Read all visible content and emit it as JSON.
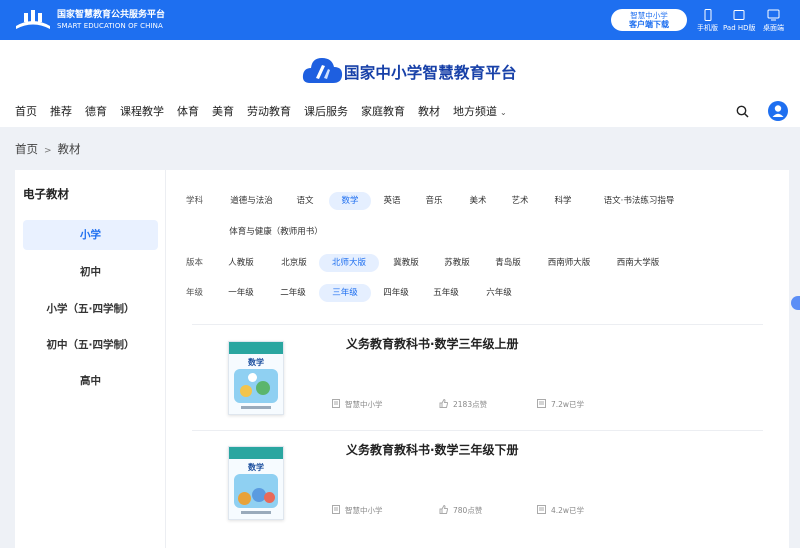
{
  "topbar": {
    "title": "国家智慧教育公共服务平台",
    "subtitle": "SMART EDUCATION OF CHINA",
    "download_line1": "智慧中小学",
    "download_line2": "客户端下载",
    "devices": [
      {
        "label": "手机版",
        "icon": "phone-icon"
      },
      {
        "label": "Pad HD版",
        "icon": "tablet-icon"
      },
      {
        "label": "桌面端",
        "icon": "desktop-icon"
      }
    ]
  },
  "header": {
    "brand": "国家中小学智慧教育平台",
    "nav": [
      "首页",
      "推荐",
      "德育",
      "课程教学",
      "体育",
      "美育",
      "劳动教育",
      "课后服务",
      "家庭教育",
      "教材",
      "地方频道"
    ]
  },
  "breadcrumb": {
    "home": "首页",
    "separator": ">",
    "current": "教材"
  },
  "sidebar": {
    "title": "电子教材",
    "items": [
      {
        "label": "小学",
        "active": true
      },
      {
        "label": "初中",
        "active": false
      },
      {
        "label": "小学（五·四学制）",
        "active": false
      },
      {
        "label": "初中（五·四学制）",
        "active": false
      },
      {
        "label": "高中",
        "active": false
      }
    ]
  },
  "filters": {
    "subject": {
      "label": "学科",
      "options": [
        "道德与法治",
        "语文",
        "数学",
        "英语",
        "音乐",
        "美术",
        "艺术",
        "科学",
        "语文·书法练习指导",
        "体育与健康（教师用书）"
      ],
      "selected": "数学"
    },
    "edition": {
      "label": "版本",
      "options": [
        "人教版",
        "北京版",
        "北师大版",
        "冀教版",
        "苏教版",
        "青岛版",
        "西南师大版",
        "西南大学版"
      ],
      "selected": "北师大版"
    },
    "grade": {
      "label": "年级",
      "options": [
        "一年级",
        "二年级",
        "三年级",
        "四年级",
        "五年级",
        "六年级"
      ],
      "selected": "三年级"
    }
  },
  "books": [
    {
      "title": "义务教育教科书·数学三年级上册",
      "cover_word": "数学",
      "publisher": "智慧中小学",
      "likes": "2183点赞",
      "learned": "7.2w已学"
    },
    {
      "title": "义务教育教科书·数学三年级下册",
      "cover_word": "数学",
      "publisher": "智慧中小学",
      "likes": "780点赞",
      "learned": "4.2w已学"
    }
  ],
  "colors": {
    "accent": "#1e6ff0",
    "topbar": "#1e6ff0",
    "active_bg": "#e5efff",
    "brand_text": "#1740a8",
    "page_bg": "#eef1f6"
  }
}
